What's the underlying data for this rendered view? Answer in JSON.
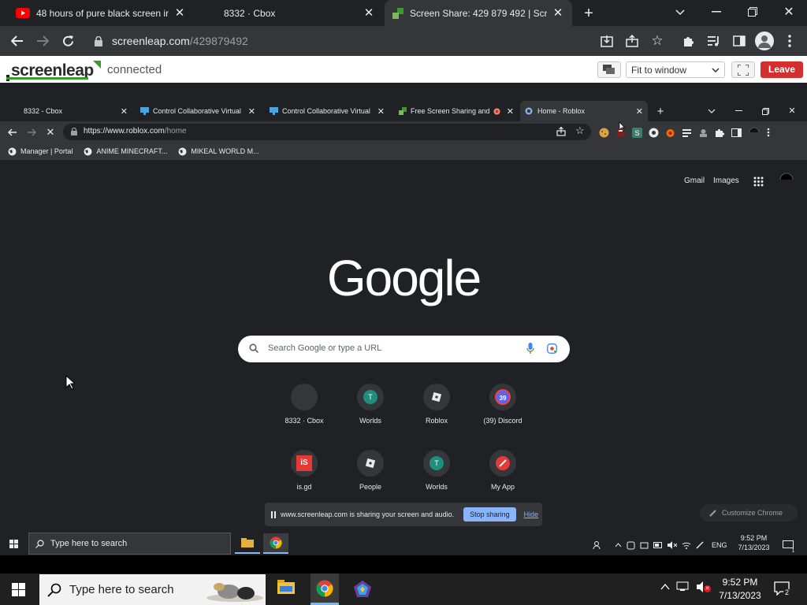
{
  "colors": {
    "chrome_dark": "#202124",
    "chrome_mid": "#35363a",
    "accent_blue": "#8ab4f8",
    "leave_red": "#d32f2f",
    "screenleap_green": "#3a9a2c"
  },
  "outer_tabs": [
    {
      "label": "48 hours of pure black screen in l",
      "icon": "youtube-icon"
    },
    {
      "label": "8332 · Cbox",
      "icon": ""
    },
    {
      "label": "Screen Share: 429 879 492 | Scre",
      "icon": "screenleap-icon",
      "active": true
    }
  ],
  "outer_url": {
    "host": "screenleap.com",
    "path": "/429879492"
  },
  "screenleap": {
    "logo": "screenleap",
    "status": "connected",
    "fit_select": "Fit to window",
    "leave": "Leave"
  },
  "inner_tabs": [
    {
      "label": "8332 - Cbox"
    },
    {
      "label": "Control Collaborative Virtual"
    },
    {
      "label": "Control Collaborative Virtual"
    },
    {
      "label": "Free Screen Sharing and"
    },
    {
      "label": "Home - Roblox",
      "active": true
    }
  ],
  "inner_url": {
    "prefix": "https://www.roblox.com",
    "path": "/home"
  },
  "bookmarks": [
    "Manager | Portal",
    "ANIME MINECRAFT...",
    "MIKEAL WORLD M..."
  ],
  "google": {
    "logo": "Google",
    "header_links": [
      "Gmail",
      "Images"
    ],
    "search_placeholder": "Search Google or type a URL",
    "shortcuts": [
      {
        "label": "8332 · Cbox",
        "badge": ""
      },
      {
        "label": "Worlds",
        "badge": "T"
      },
      {
        "label": "Roblox",
        "badge": ""
      },
      {
        "label": "(39) Discord",
        "badge": "39"
      },
      {
        "label": "is.gd",
        "badge": "iS"
      },
      {
        "label": "People",
        "badge": ""
      },
      {
        "label": "Worlds",
        "badge": "T"
      },
      {
        "label": "My App",
        "badge": ""
      }
    ],
    "customize": "Customize Chrome"
  },
  "share_notice": {
    "text": "www.screenleap.com is sharing your screen and audio.",
    "stop": "Stop sharing",
    "hide": "Hide"
  },
  "inner_taskbar": {
    "search": "Type here to search",
    "lang": "ENG",
    "time": "9:52 PM",
    "date": "7/13/2023",
    "notif_count": "1"
  },
  "os_taskbar": {
    "search": "Type here to search",
    "time": "9:52 PM",
    "date": "7/13/2023",
    "notif_count": "2"
  }
}
